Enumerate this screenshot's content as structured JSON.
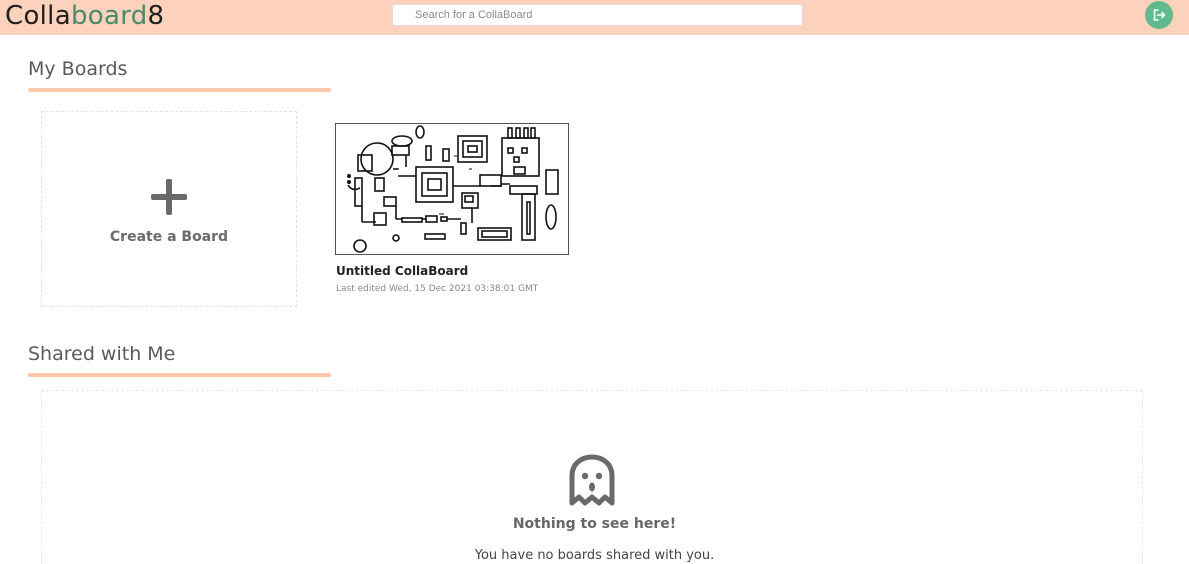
{
  "header": {
    "logo_part1": "Colla",
    "logo_part2": "board",
    "logo_part3": "8",
    "search_placeholder": "Search for a CollaBoard",
    "logout_icon": "logout-icon",
    "colors": {
      "background": "#fcd2bc",
      "logo_accent": "#4a8a6a",
      "logout_button": "#5fbb8e"
    }
  },
  "my_boards": {
    "title": "My Boards",
    "create_label": "Create a Board",
    "boards": [
      {
        "title": "Untitled CollaBoard",
        "last_edited": "Last edited Wed, 15 Dec 2021 03:38:01 GMT"
      }
    ]
  },
  "shared": {
    "title": "Shared with Me",
    "empty_icon": "ghost-icon",
    "empty_title": "Nothing to see here!",
    "empty_subtitle": "You have no boards shared with you."
  }
}
